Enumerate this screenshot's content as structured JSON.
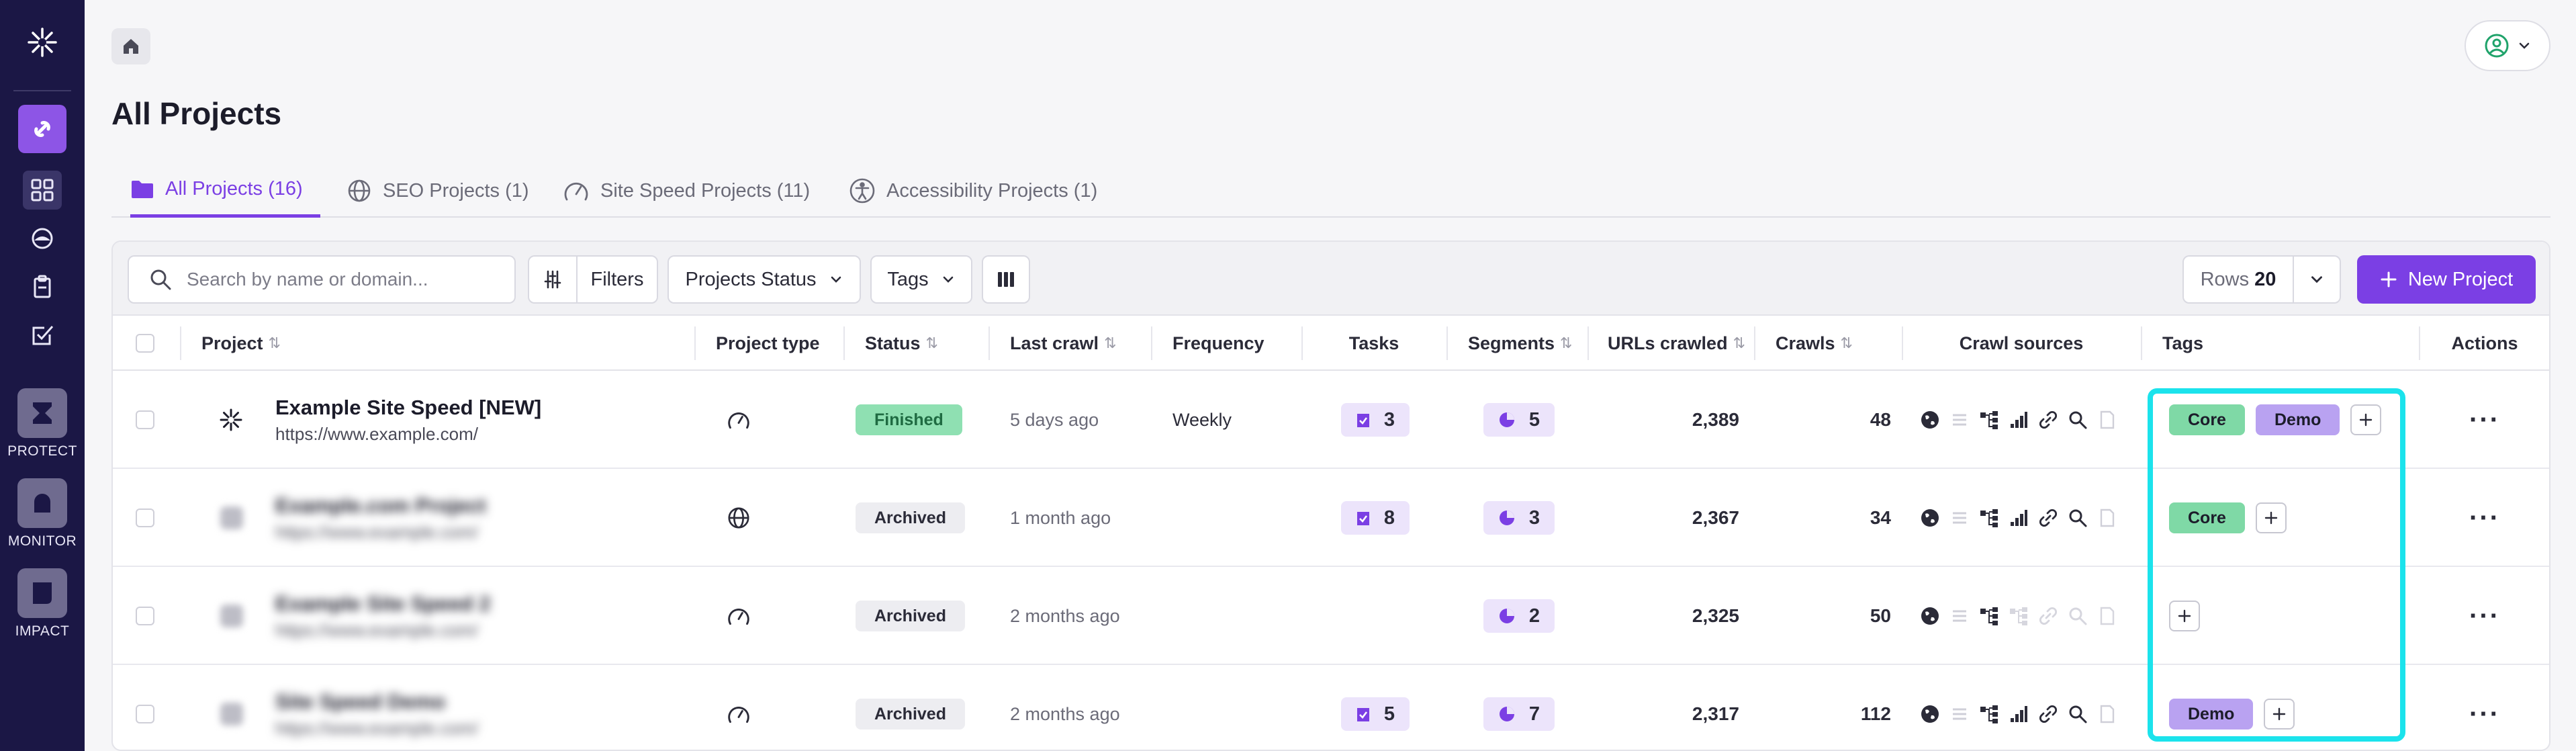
{
  "rail": {
    "logo_icon": "sparkle-logo",
    "products": [
      {
        "label": "PROTECT",
        "icon": "hourglass-icon"
      },
      {
        "label": "MONITOR",
        "icon": "bell-icon"
      },
      {
        "label": "IMPACT",
        "icon": "document-icon"
      }
    ]
  },
  "page": {
    "title": "All Projects"
  },
  "tabs": [
    {
      "label": "All Projects (16)",
      "icon": "folder-icon",
      "active": true
    },
    {
      "label": "SEO Projects (1)",
      "icon": "globe-icon",
      "active": false
    },
    {
      "label": "Site Speed Projects (11)",
      "icon": "speedometer-icon",
      "active": false
    },
    {
      "label": "Accessibility Projects (1)",
      "icon": "accessibility-icon",
      "active": false
    }
  ],
  "toolbar": {
    "search_placeholder": "Search by name or domain...",
    "filters_label": "Filters",
    "status_label": "Projects Status",
    "tags_label": "Tags",
    "rows_label": "Rows",
    "rows_value": "20",
    "new_project_label": "New Project"
  },
  "columns": {
    "project": "Project",
    "type": "Project type",
    "status": "Status",
    "last_crawl": "Last crawl",
    "frequency": "Frequency",
    "tasks": "Tasks",
    "segments": "Segments",
    "urls": "URLs crawled",
    "crawls": "Crawls",
    "sources": "Crawl sources",
    "tags": "Tags",
    "actions": "Actions"
  },
  "rows": [
    {
      "name": "Example Site Speed [NEW]",
      "url": "https://www.example.com/",
      "type_icon": "speedometer-icon",
      "status": "Finished",
      "last_crawl": "5 days ago",
      "frequency": "Weekly",
      "tasks": "3",
      "segments": "5",
      "urls": "2,389",
      "crawls": "48",
      "tags": [
        "Core",
        "Demo"
      ]
    },
    {
      "name": "Example.com Project",
      "url": "https://www.example.com/",
      "type_icon": "globe-icon",
      "status": "Archived",
      "last_crawl": "1 month ago",
      "frequency": "",
      "tasks": "8",
      "segments": "3",
      "urls": "2,367",
      "crawls": "34",
      "tags": [
        "Core"
      ]
    },
    {
      "name": "Example Site Speed 2",
      "url": "https://www.example.com/",
      "type_icon": "speedometer-icon",
      "status": "Archived",
      "last_crawl": "2 months ago",
      "frequency": "",
      "tasks": "",
      "segments": "2",
      "urls": "2,325",
      "crawls": "50",
      "tags": []
    },
    {
      "name": "Site Speed Demo",
      "url": "https://www.example.com/",
      "type_icon": "speedometer-icon",
      "status": "Archived",
      "last_crawl": "2 months ago",
      "frequency": "",
      "tasks": "5",
      "segments": "7",
      "urls": "2,317",
      "crawls": "112",
      "tags": [
        "Demo"
      ]
    }
  ],
  "colors": {
    "accent": "#7b3fe4",
    "rail": "#1b1745",
    "highlight": "#1be3ec",
    "tag_core": "#7fd9a6",
    "tag_demo": "#b9a2f1"
  }
}
